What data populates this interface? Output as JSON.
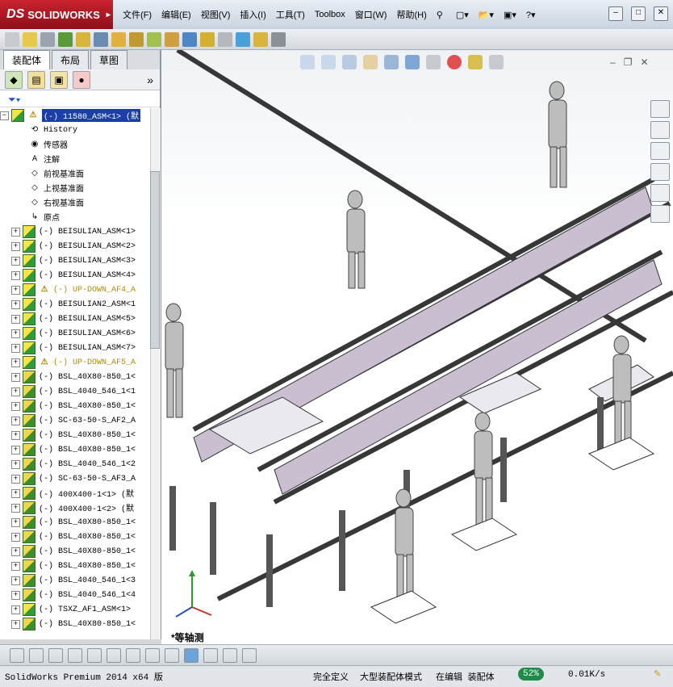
{
  "app": {
    "logo_text": "SOLIDWORKS",
    "logo_prefix": "DS",
    "brand_color": "#c9232f"
  },
  "menu": [
    "文件(F)",
    "编辑(E)",
    "视图(V)",
    "插入(I)",
    "工具(T)",
    "Toolbox",
    "窗口(W)",
    "帮助(H)"
  ],
  "panel": {
    "tabs": [
      "装配体",
      "布局",
      "草图"
    ],
    "active_tab": 0,
    "expand_label": "»"
  },
  "tree": {
    "root_label": "(-) 11580_ASM<1> (默",
    "items": [
      {
        "label": "History",
        "icon": "history-icon",
        "expander": ""
      },
      {
        "label": "传感器",
        "icon": "sensor-icon",
        "expander": ""
      },
      {
        "label": "注解",
        "icon": "annotation-icon",
        "expander": ""
      },
      {
        "label": "前视基准面",
        "icon": "plane-icon",
        "expander": ""
      },
      {
        "label": "上视基准面",
        "icon": "plane-icon",
        "expander": ""
      },
      {
        "label": "右视基准面",
        "icon": "plane-icon",
        "expander": ""
      },
      {
        "label": "原点",
        "icon": "origin-icon",
        "expander": ""
      },
      {
        "label": "(-) BEISULIAN_ASM<1>",
        "icon": "assembly-icon",
        "expander": "+"
      },
      {
        "label": "(-) BEISULIAN_ASM<2>",
        "icon": "assembly-icon",
        "expander": "+"
      },
      {
        "label": "(-) BEISULIAN_ASM<3>",
        "icon": "assembly-icon",
        "expander": "+"
      },
      {
        "label": "(-) BEISULIAN_ASM<4>",
        "icon": "assembly-icon",
        "expander": "+"
      },
      {
        "label": "(-) UP-DOWN_AF4_A",
        "icon": "assembly-warning-icon",
        "expander": "+",
        "warn": true
      },
      {
        "label": "(-) BEISULIAN2_ASM<1",
        "icon": "assembly-icon",
        "expander": "+"
      },
      {
        "label": "(-) BEISULIAN_ASM<5>",
        "icon": "assembly-icon",
        "expander": "+"
      },
      {
        "label": "(-) BEISULIAN_ASM<6>",
        "icon": "assembly-icon",
        "expander": "+"
      },
      {
        "label": "(-) BEISULIAN_ASM<7>",
        "icon": "assembly-icon",
        "expander": "+"
      },
      {
        "label": "(-) UP-DOWN_AF5_A",
        "icon": "assembly-warning-icon",
        "expander": "+",
        "warn": true
      },
      {
        "label": "(-) BSL_40X80-850_1<",
        "icon": "part-icon",
        "expander": "+"
      },
      {
        "label": "(-) BSL_4040_546_1<1",
        "icon": "part-icon",
        "expander": "+"
      },
      {
        "label": "(-) BSL_40X80-850_1<",
        "icon": "part-icon",
        "expander": "+"
      },
      {
        "label": "(-) SC-63-50-S_AF2_A",
        "icon": "part-icon",
        "expander": "+"
      },
      {
        "label": "(-) BSL_40X80-850_1<",
        "icon": "part-icon",
        "expander": "+"
      },
      {
        "label": "(-) BSL_40X80-850_1<",
        "icon": "part-icon",
        "expander": "+"
      },
      {
        "label": "(-) BSL_4040_546_1<2",
        "icon": "part-icon",
        "expander": "+"
      },
      {
        "label": "(-) SC-63-50-S_AF3_A",
        "icon": "part-icon",
        "expander": "+"
      },
      {
        "label": "(-) 400X400-1<1> (默",
        "icon": "part-icon",
        "expander": "+"
      },
      {
        "label": "(-) 400X400-1<2> (默",
        "icon": "part-icon",
        "expander": "+"
      },
      {
        "label": "(-) BSL_40X80-850_1<",
        "icon": "part-icon",
        "expander": "+"
      },
      {
        "label": "(-) BSL_40X80-850_1<",
        "icon": "part-icon",
        "expander": "+"
      },
      {
        "label": "(-) BSL_40X80-850_1<",
        "icon": "part-icon",
        "expander": "+"
      },
      {
        "label": "(-) BSL_40X80-850_1<",
        "icon": "part-icon",
        "expander": "+"
      },
      {
        "label": "(-) BSL_4040_546_1<3",
        "icon": "part-icon",
        "expander": "+"
      },
      {
        "label": "(-) BSL_4040_546_1<4",
        "icon": "part-icon",
        "expander": "+"
      },
      {
        "label": "(-) TSXZ_AF1_ASM<1>",
        "icon": "assembly-icon",
        "expander": "+"
      },
      {
        "label": "(-) BSL_40X80-850_1<",
        "icon": "part-icon",
        "expander": "+"
      }
    ]
  },
  "viewport": {
    "view_label": "*等轴测"
  },
  "status": {
    "app_version": "SolidWorks Premium 2014 x64 版",
    "definition": "完全定义",
    "mode": "大型装配体模式",
    "editing": "在编辑 装配体",
    "speed_percent": "52%",
    "speed_rate": "0.01K/s"
  }
}
